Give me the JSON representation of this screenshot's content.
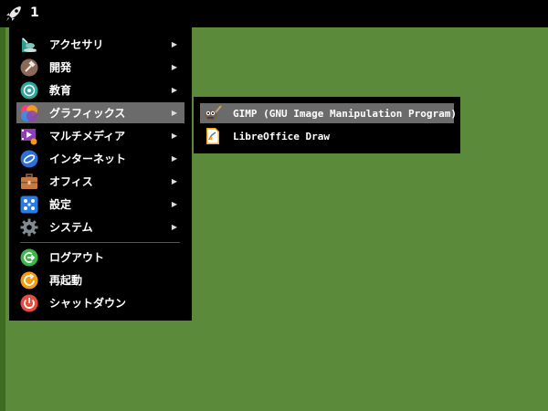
{
  "topbar": {
    "launcher_icon": "rocket-icon",
    "workspace": "1"
  },
  "menu": {
    "items": [
      {
        "label": "アクセサリ",
        "icon": "accessories-icon",
        "submenu": true
      },
      {
        "label": "開発",
        "icon": "development-icon",
        "submenu": true
      },
      {
        "label": "教育",
        "icon": "education-icon",
        "submenu": true
      },
      {
        "label": "グラフィックス",
        "icon": "graphics-icon",
        "submenu": true,
        "active": true
      },
      {
        "label": "マルチメディア",
        "icon": "multimedia-icon",
        "submenu": true
      },
      {
        "label": "インターネット",
        "icon": "internet-icon",
        "submenu": true
      },
      {
        "label": "オフィス",
        "icon": "office-icon",
        "submenu": true
      },
      {
        "label": "設定",
        "icon": "settings-icon",
        "submenu": true
      },
      {
        "label": "システム",
        "icon": "system-icon",
        "submenu": true
      },
      {
        "label": "ログアウト",
        "icon": "logout-icon",
        "submenu": false
      },
      {
        "label": "再起動",
        "icon": "restart-icon",
        "submenu": false
      },
      {
        "label": "シャットダウン",
        "icon": "shutdown-icon",
        "submenu": false
      }
    ],
    "arrow": "▶"
  },
  "submenu": {
    "items": [
      {
        "label": "GIMP (GNU Image Manipulation Program)",
        "icon": "gimp-icon",
        "active": true
      },
      {
        "label": "LibreOffice Draw",
        "icon": "libreoffice-draw-icon"
      }
    ]
  },
  "colors": {
    "desktop": "#5b8a3a",
    "menu_bg": "#000000",
    "highlight": "#6b6b6b"
  }
}
